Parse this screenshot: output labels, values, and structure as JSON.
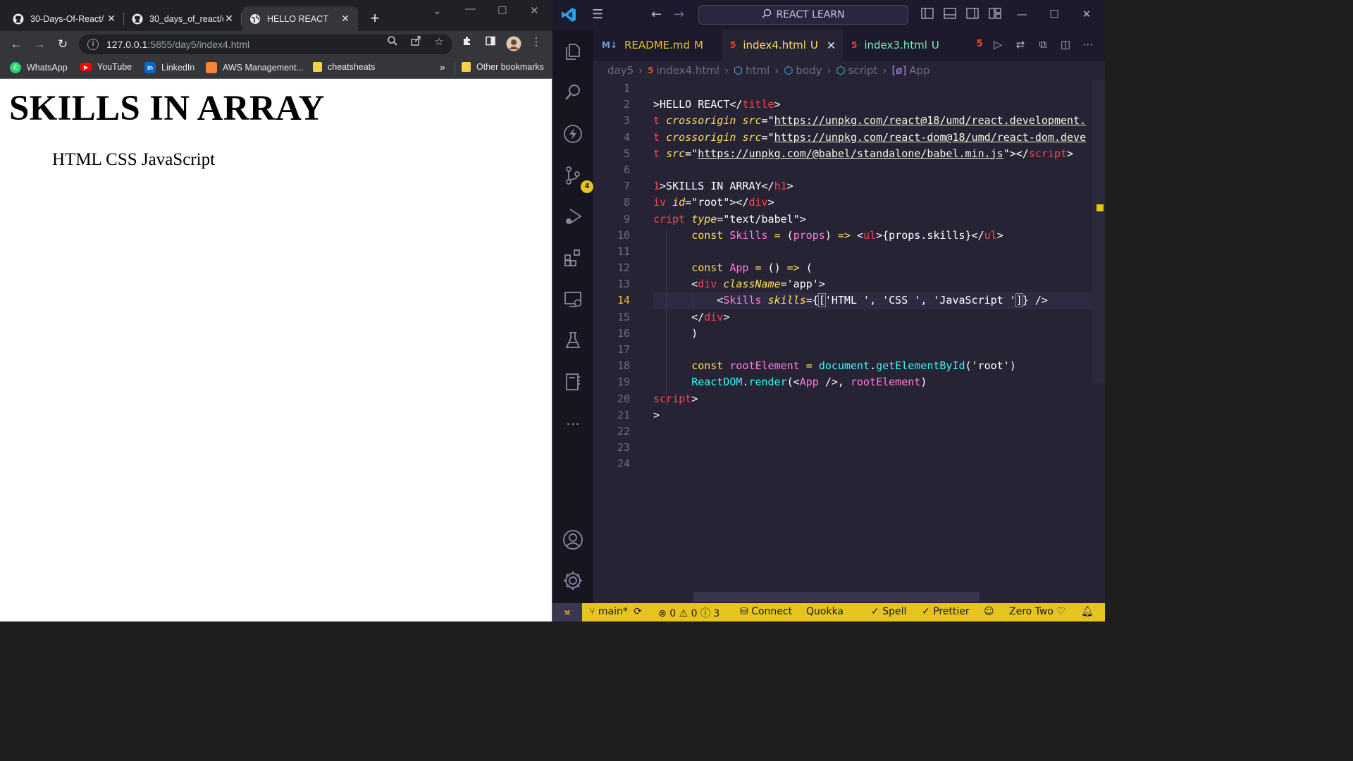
{
  "browser": {
    "tabs": [
      {
        "title": "30-Days-Of-React/",
        "icon": "github-icon"
      },
      {
        "title": "30_days_of_react/c",
        "icon": "github-icon"
      },
      {
        "title": "HELLO REACT",
        "icon": "globe-icon",
        "active": true
      }
    ],
    "url_host": "127.0.0.1",
    "url_path": ":5855/day5/index4.html",
    "bookmarks": [
      "WhatsApp",
      "YouTube",
      "LinkedIn",
      "AWS Management...",
      "cheatsheats"
    ],
    "bookmarks_overflow": "»",
    "other_bookmarks": "Other bookmarks",
    "page": {
      "heading": "SKILLS IN ARRAY",
      "skills": "HTML CSS JavaScript"
    }
  },
  "vscode": {
    "search": "REACT LEARN",
    "tabs": [
      {
        "label": "README.md",
        "mark": "M",
        "icon": "markdown-icon"
      },
      {
        "label": "index4.html",
        "mark": "U",
        "icon": "html5-icon",
        "active": true
      },
      {
        "label": "index3.html",
        "mark": "U",
        "icon": "html5-icon"
      }
    ],
    "breadcrumb": [
      "day5",
      "index4.html",
      "html",
      "body",
      "script",
      "App"
    ],
    "line_numbers": [
      "1",
      "2",
      "3",
      "4",
      "5",
      "6",
      "7",
      "8",
      "9",
      "10",
      "11",
      "12",
      "13",
      "14",
      "15",
      "16",
      "17",
      "18",
      "19",
      "20",
      "21",
      "22",
      "23",
      "24"
    ],
    "current_line": 14,
    "scm_badge": "4",
    "status": {
      "branch": "main*",
      "errors": "0",
      "warnings": "0",
      "info": "3",
      "connect": "Connect",
      "quokka": "Quokka",
      "spell": "Spell",
      "prettier": "Prettier",
      "theme": "Zero Two"
    },
    "colors": {
      "accent": "#e6c31f",
      "background": "#262335",
      "tag": "#72f1b8",
      "keyword": "#fede5d",
      "name": "#ff7edb",
      "function": "#36f9f6"
    }
  }
}
